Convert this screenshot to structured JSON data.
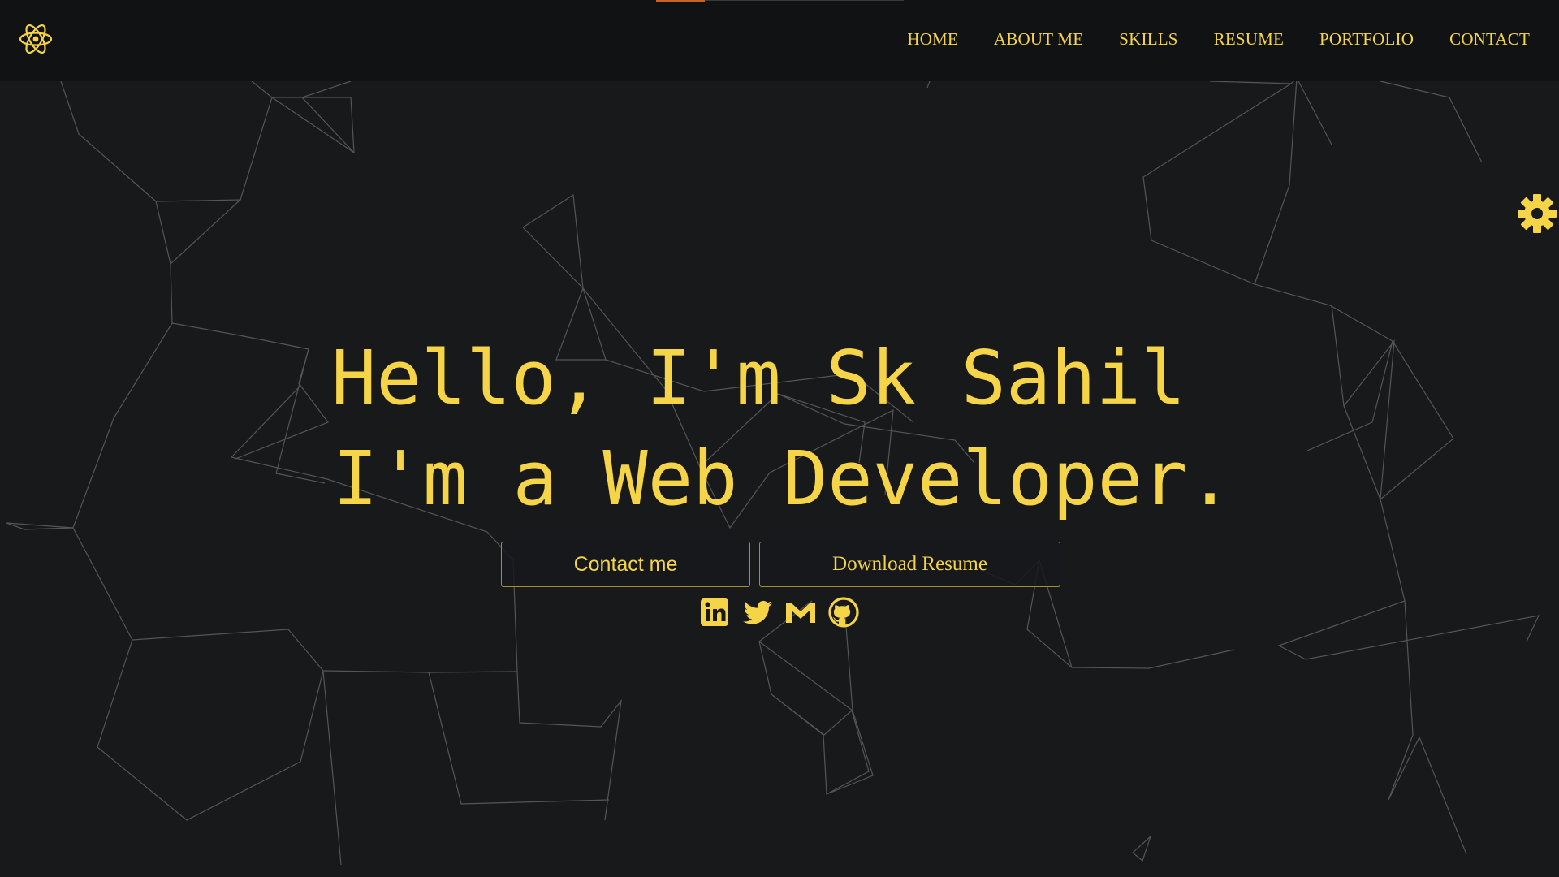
{
  "theme": {
    "accent": "#f5d547",
    "background": "#18191b",
    "navbar": "#111213",
    "progress": "#c8642a"
  },
  "logo": {
    "icon": "react-atom-icon"
  },
  "nav": {
    "items": [
      {
        "label": "HOME"
      },
      {
        "label": "ABOUT ME"
      },
      {
        "label": "SKILLS"
      },
      {
        "label": "RESUME"
      },
      {
        "label": "PORTFOLIO"
      },
      {
        "label": "CONTACT"
      }
    ]
  },
  "settings": {
    "icon": "gear-icon"
  },
  "hero": {
    "greeting": "Hello, I'm Sk Sahil",
    "tagline": "I'm a Web Developer."
  },
  "buttons": {
    "contact_label": "Contact me",
    "resume_label": "Download Resume"
  },
  "socials": [
    {
      "icon": "linkedin-icon"
    },
    {
      "icon": "twitter-icon"
    },
    {
      "icon": "gmail-icon"
    },
    {
      "icon": "github-icon"
    }
  ]
}
